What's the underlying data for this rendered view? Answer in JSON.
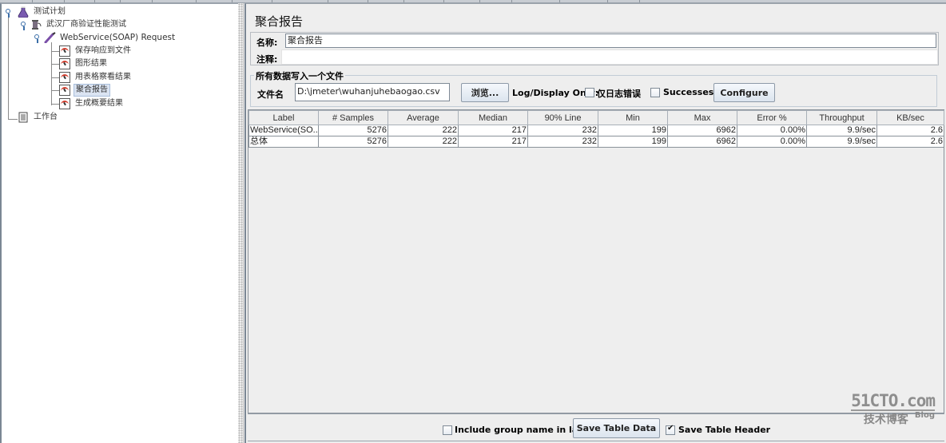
{
  "tree": {
    "root": {
      "label": "测试计划",
      "icon": "test-plan-flask-icon"
    },
    "thread_group": {
      "label": "武汉厂商验证性能测试",
      "icon": "thread-group-spool-icon"
    },
    "sampler": {
      "label": "WebService(SOAP) Request",
      "icon": "sampler-pipette-icon"
    },
    "listeners": [
      {
        "label": "保存响应到文件",
        "selected": false
      },
      {
        "label": "图形结果",
        "selected": false
      },
      {
        "label": "用表格察看结果",
        "selected": false
      },
      {
        "label": "聚合报告",
        "selected": true
      },
      {
        "label": "生成概要结果",
        "selected": false
      }
    ],
    "workbench": {
      "label": "工作台",
      "icon": "workbench-clipboard-icon"
    }
  },
  "panel": {
    "title": "聚合报告",
    "name_label": "名称:",
    "name_value": "聚合报告",
    "comment_label": "注释:",
    "comment_value": "",
    "file_group_legend": "所有数据写入一个文件",
    "filename_label": "文件名",
    "filename_value": "D:\\jmeter\\wuhanjuhebaogao.csv",
    "browse_button": "浏览...",
    "log_display_label": "Log/Display Only:",
    "errors_only_label": "仅日志错误",
    "errors_only_checked": false,
    "successes_label": "Successes",
    "successes_checked": false,
    "configure_button": "Configure"
  },
  "table": {
    "columns": [
      "Label",
      "# Samples",
      "Average",
      "Median",
      "90% Line",
      "Min",
      "Max",
      "Error %",
      "Throughput",
      "KB/sec"
    ],
    "rows": [
      [
        "WebService(SO...",
        "5276",
        "222",
        "217",
        "232",
        "199",
        "6962",
        "0.00%",
        "9.9/sec",
        "2.6"
      ],
      [
        "总体",
        "5276",
        "222",
        "217",
        "232",
        "199",
        "6962",
        "0.00%",
        "9.9/sec",
        "2.6"
      ]
    ]
  },
  "bottom": {
    "include_group_label": "Include group name in label?",
    "include_group_checked": false,
    "save_table_data_button": "Save Table Data",
    "save_table_header_label": "Save Table Header",
    "save_table_header_checked": true
  },
  "watermark": {
    "main": "51CTO.com",
    "sub": "技术博客",
    "blog": "Blog"
  }
}
